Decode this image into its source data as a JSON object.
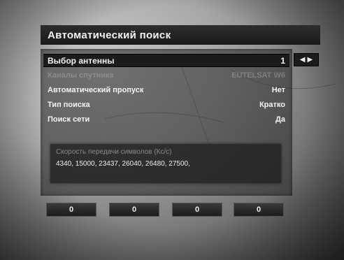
{
  "title": "Автоматический поиск",
  "rows": [
    {
      "label": "Выбор антенны",
      "value": "1"
    },
    {
      "label": "Каналы спутника",
      "value": "EUTELSAT W6"
    },
    {
      "label": "Автоматический пропуск",
      "value": "Нет"
    },
    {
      "label": "Тип поиска",
      "value": "Кратко"
    },
    {
      "label": "Поиск сети",
      "value": "Да"
    }
  ],
  "symbol_rate": {
    "label": "Скорость передачи символов (Кс/с)",
    "values": "4340, 15000, 23437, 26040, 26480, 27500,"
  },
  "bottom_buttons": [
    "0",
    "0",
    "0",
    "0"
  ],
  "icons": {
    "arrows": "left-right-arrows-icon"
  }
}
